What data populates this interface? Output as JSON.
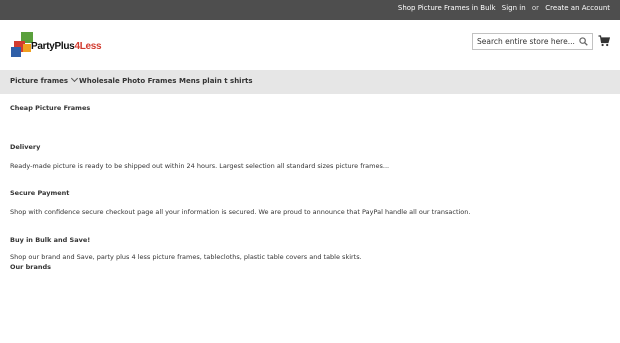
{
  "topbar": {
    "link_shop": "Shop Picture Frames in Bulk",
    "link_signin": "Sign in",
    "or_text": "or",
    "link_create": "Create an Account"
  },
  "header": {
    "logo_text_main": "PartyPlus",
    "logo_text_accent": "4Less",
    "search_placeholder": "Search entire store here...",
    "search_icon": "search-icon",
    "cart_icon": "cart-icon"
  },
  "nav": {
    "items": [
      {
        "label": "Picture frames",
        "has_dropdown": true
      },
      {
        "label": "Wholesale Photo Frames"
      },
      {
        "label": "Mens plain t shirts"
      }
    ]
  },
  "main": {
    "title": "Cheap Picture Frames",
    "sections": [
      {
        "heading": "Delivery",
        "text": "Ready-made picture is ready to be shipped out within 24 hours. Largest selection all standard sizes picture frames..."
      },
      {
        "heading": "Secure Payment",
        "text": "Shop with confidence secure checkout page all your information is secured. We are proud to announce that PayPal handle all our transaction."
      },
      {
        "heading": "Buy in Bulk and Save!",
        "text": "Shop our brand and Save, party plus 4 less picture frames, tablecloths, plastic table covers and table skirts."
      }
    ],
    "brands_heading": "Our brands"
  },
  "colors": {
    "topbar_bg": "#4e4e4e",
    "nav_bg": "#e6e6e6",
    "logo_red": "#d23b2f",
    "logo_green": "#5aa03c",
    "logo_blue": "#2f5fa8",
    "logo_orange": "#f0a020"
  }
}
